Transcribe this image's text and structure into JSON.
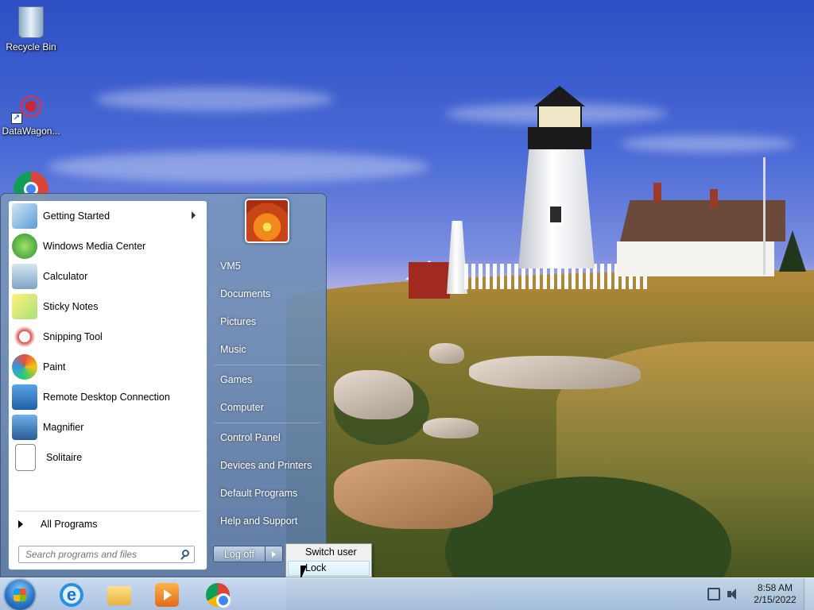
{
  "desktop": {
    "icons": [
      {
        "label": "Recycle Bin",
        "icon": "recycle-bin-icon"
      },
      {
        "label": "DataWagon...",
        "icon": "datawagon-icon"
      },
      {
        "label": "",
        "icon": "chrome-icon"
      }
    ]
  },
  "start_menu": {
    "programs": [
      {
        "label": "Getting Started",
        "icon": "getting-started-icon",
        "has_submenu": true
      },
      {
        "label": "Windows Media Center",
        "icon": "media-center-icon"
      },
      {
        "label": "Calculator",
        "icon": "calculator-icon"
      },
      {
        "label": "Sticky Notes",
        "icon": "sticky-notes-icon"
      },
      {
        "label": "Snipping Tool",
        "icon": "snipping-tool-icon"
      },
      {
        "label": "Paint",
        "icon": "paint-icon"
      },
      {
        "label": "Remote Desktop Connection",
        "icon": "remote-desktop-icon"
      },
      {
        "label": "Magnifier",
        "icon": "magnifier-icon"
      },
      {
        "label": "Solitaire",
        "icon": "solitaire-icon"
      }
    ],
    "all_programs": "All Programs",
    "search_placeholder": "Search programs and files",
    "user_name": "VM5",
    "right_items": [
      {
        "label": "VM5"
      },
      {
        "label": "Documents"
      },
      {
        "label": "Pictures"
      },
      {
        "label": "Music"
      },
      {
        "label": "Games"
      },
      {
        "label": "Computer"
      },
      {
        "label": "Control Panel"
      },
      {
        "label": "Devices and Printers"
      },
      {
        "label": "Default Programs"
      },
      {
        "label": "Help and Support"
      }
    ],
    "logoff_label": "Log off",
    "power_menu": [
      {
        "label": "Switch user"
      },
      {
        "label": "Lock",
        "hovered": true
      }
    ]
  },
  "taskbar": {
    "pinned": [
      {
        "name": "internet-explorer",
        "icon": "internet-explorer-icon"
      },
      {
        "name": "file-explorer",
        "icon": "folder-icon"
      },
      {
        "name": "media-player",
        "icon": "media-player-icon"
      },
      {
        "name": "chrome",
        "icon": "chrome-icon"
      }
    ],
    "clock_time": "8:58 AM",
    "clock_date": "2/15/2022"
  }
}
